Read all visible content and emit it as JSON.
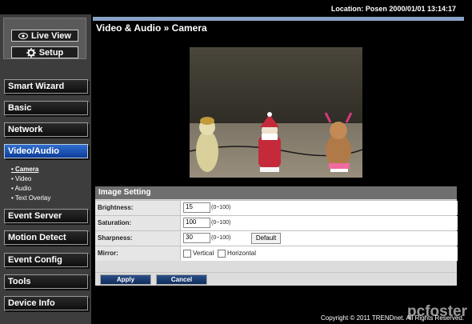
{
  "status": {
    "location": "Location: Posen   2000/01/01 13:14:17"
  },
  "view": {
    "live_label": "Live View",
    "setup_label": "Setup"
  },
  "nav": {
    "items": [
      "Smart Wizard",
      "Basic",
      "Network",
      "Video/Audio",
      "Event Server",
      "Motion Detect",
      "Event Config",
      "Tools",
      "Device Info"
    ],
    "active": "Video/Audio",
    "sub_items": [
      "• Camera",
      "• Video",
      "• Audio",
      "• Text Overlay"
    ],
    "active_sub": "• Camera"
  },
  "page": {
    "title": "Video & Audio » Camera"
  },
  "image_setting": {
    "header": "Image Setting",
    "brightness": {
      "label": "Brightness:",
      "value": "15",
      "range": "(0~100)"
    },
    "saturation": {
      "label": "Saturation:",
      "value": "100",
      "range": "(0~100)"
    },
    "sharpness": {
      "label": "Sharpness:",
      "value": "30",
      "range": "(0~100)"
    },
    "default_label": "Default",
    "mirror": {
      "label": "Mirror:",
      "vertical": "Vertical",
      "horizontal": "Horizontal"
    }
  },
  "actions": {
    "apply": "Apply",
    "cancel": "Cancel"
  },
  "footer": {
    "copyright": "Copyright © 2011 TRENDnet. All Rights Reserved."
  },
  "watermark": "pcfoster",
  "colors": {
    "accent": "#8aa2c8",
    "active_nav": "#1f58b8"
  }
}
